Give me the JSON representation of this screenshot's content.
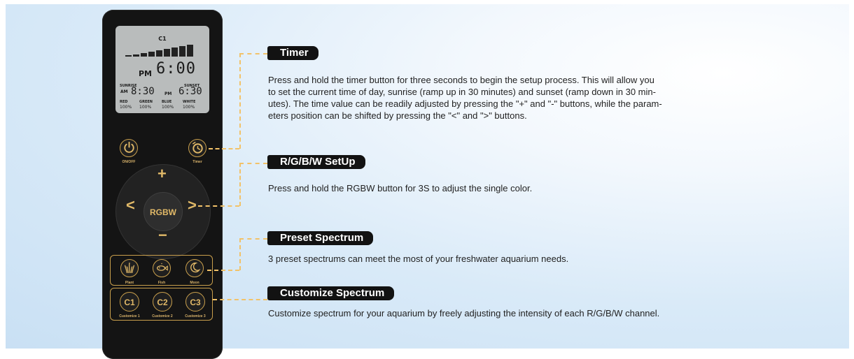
{
  "lcd": {
    "mode": "C1",
    "ampm": "PM",
    "time": "6:00",
    "sunrise_label": "SUNRISE",
    "sunrise_ampm": "AM",
    "sunrise_time": "8:30",
    "sunset_label": "SUNSET",
    "sunset_ampm": "PM",
    "sunset_time": "6:30",
    "channels": [
      {
        "name": "RED",
        "value": "100%"
      },
      {
        "name": "GREEN",
        "value": "100%"
      },
      {
        "name": "BLUE",
        "value": "100%"
      },
      {
        "name": "WHITE",
        "value": "100%"
      }
    ]
  },
  "remote": {
    "onoff_label": "ON/OFF",
    "timer_label": "Timer",
    "rgbw_label": "RGBW",
    "plus": "+",
    "minus": "−",
    "left": "<",
    "right": ">",
    "presets": [
      {
        "label": "Plant",
        "icon": "plant-icon"
      },
      {
        "label": "Fish",
        "icon": "fish-icon"
      },
      {
        "label": "Moon",
        "icon": "moon-icon"
      }
    ],
    "customs": [
      {
        "text": "C1",
        "label": "Customize 1"
      },
      {
        "text": "C2",
        "label": "Customize 2"
      },
      {
        "text": "C3",
        "label": "Customize 3"
      }
    ]
  },
  "sections": {
    "timer": {
      "title": "Timer",
      "lines": [
        "Press and hold the timer button for three seconds to begin the setup process. This will allow you",
        "to set the current time of day, sunrise (ramp up in 30 minutes) and sunset (ramp down in 30 min-",
        "utes). The time value can be readily adjusted by pressing the \"+\" and \"-\" buttons, while the param-",
        "eters position can be shifted by pressing the \"<\" and \">\" buttons."
      ]
    },
    "rgbw": {
      "title": "R/G/B/W SetUp",
      "text": "Press and hold the RGBW button for 3S to adjust the single color."
    },
    "preset": {
      "title": "Preset Spectrum",
      "text": "3 preset spectrums can meet the most of your freshwater aquarium needs."
    },
    "customize": {
      "title": "Customize Spectrum",
      "text": "Customize spectrum for your aquarium by freely adjusting the intensity of each R/G/B/W channel."
    }
  },
  "colors": {
    "accent": "#c99f4c",
    "dash": "#f2c269",
    "title_bg": "#121212"
  }
}
